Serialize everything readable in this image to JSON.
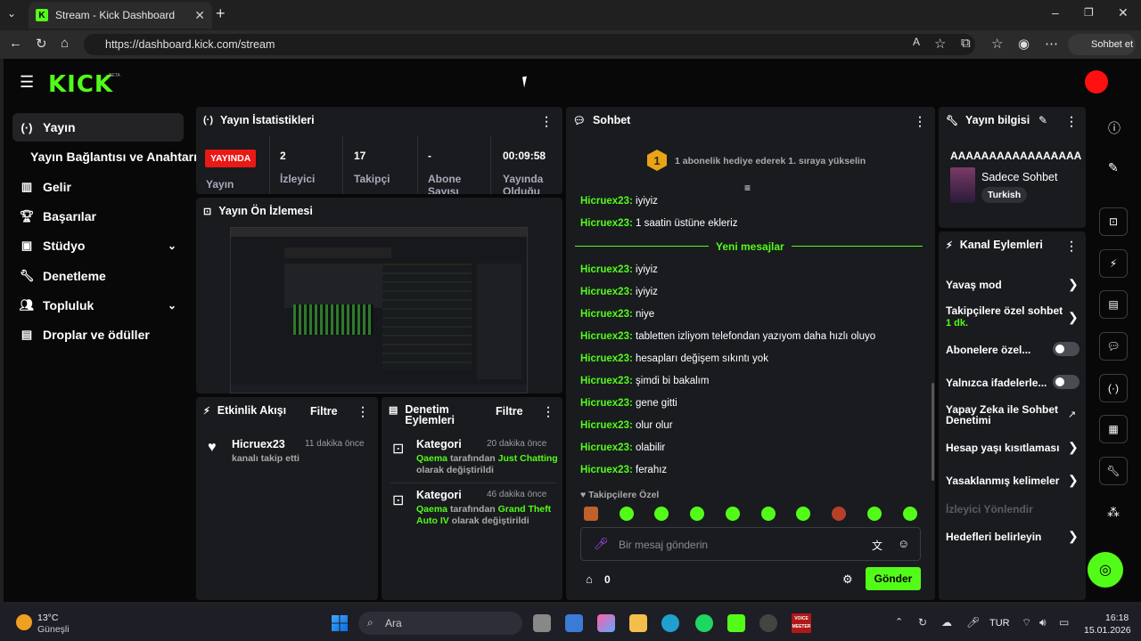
{
  "browser": {
    "tab_title": "Stream - Kick Dashboard",
    "url": "https://dashboard.kick.com/stream",
    "copilot_label": "Sohbet et"
  },
  "logo": {
    "text": "KICK",
    "badge": "BETA"
  },
  "sidebar": {
    "items": [
      {
        "label": "Yayın",
        "icon": "broadcast-icon"
      },
      {
        "label": "Yayın Bağlantısı ve Anahtarı",
        "icon": ""
      },
      {
        "label": "Gelir",
        "icon": "chart-icon"
      },
      {
        "label": "Başarılar",
        "icon": "trophy-icon"
      },
      {
        "label": "Stüdyo",
        "icon": "studio-icon"
      },
      {
        "label": "Denetleme",
        "icon": "wrench-icon"
      },
      {
        "label": "Topluluk",
        "icon": "people-icon"
      },
      {
        "label": "Droplar ve ödüller",
        "icon": "gift-icon"
      }
    ]
  },
  "stats": {
    "title": "Yayın İstatistikleri",
    "live_badge": "YAYINDA",
    "live_label": "Yayın",
    "viewers_value": "2",
    "viewers_label": "İzleyici",
    "followers_value": "17",
    "followers_label": "Takipçi",
    "subs_value": "-",
    "subs_label": "Abone Sayısı",
    "uptime_value": "00:09:58",
    "uptime_label": "Yayında Olduğu"
  },
  "preview": {
    "title": "Yayın Ön İzlemesi"
  },
  "activity": {
    "title": "Etkinlik Akışı",
    "filter": "Filtre",
    "items": [
      {
        "user": "Hicruex23",
        "time": "11 dakika önce",
        "text": "kanalı takip etti"
      }
    ]
  },
  "moderation": {
    "title": "Denetim Eylemleri",
    "filter": "Filtre",
    "items": [
      {
        "label": "Kategori",
        "time": "20 dakika önce",
        "user": "Qaema",
        "mid": "tarafından",
        "value": "Just Chatting",
        "suffix": "olarak değiştirildi"
      },
      {
        "label": "Kategori",
        "time": "46 dakika önce",
        "user": "Qaema",
        "mid": "tarafından",
        "value": "Grand Theft Auto IV",
        "suffix": "olarak değiştirildi"
      }
    ]
  },
  "chat": {
    "title": "Sohbet",
    "pinned": "1 abonelik hediye ederek 1. sıraya yükselin",
    "pinned_rank": "1",
    "new_messages": "Yeni mesajlar",
    "messages_before": [
      {
        "user": "Hicruex23:",
        "text": "iyiyiz"
      },
      {
        "user": "Hicruex23:",
        "text": "1 saatin üstüne ekleriz"
      }
    ],
    "messages_after": [
      {
        "user": "Hicruex23:",
        "text": "iyiyiz"
      },
      {
        "user": "Hicruex23:",
        "text": "iyiyiz"
      },
      {
        "user": "Hicruex23:",
        "text": "niye"
      },
      {
        "user": "Hicruex23:",
        "text": "tabletten izliyom telefondan yazıyom daha hızlı oluyo"
      },
      {
        "user": "Hicruex23:",
        "text": "hesapları değişem sıkıntı yok"
      },
      {
        "user": "Hicruex23:",
        "text": "şimdi bi bakalım"
      },
      {
        "user": "Hicruex23:",
        "text": "gene gitti"
      },
      {
        "user": "Hicruex23:",
        "text": "olur olur"
      },
      {
        "user": "Hicruex23:",
        "text": "olabilir"
      },
      {
        "user": "Hicruex23:",
        "text": "ferahız"
      }
    ],
    "followers_only": "Takipçilere Özel",
    "input_placeholder": "Bir mesaj gönderin",
    "points": "0",
    "send_label": "Gönder"
  },
  "info": {
    "title": "Yayın bilgisi",
    "stream_title": "AAAAAAAAAAAAAAAAA",
    "category": "Sadece Sohbet",
    "language": "Turkish"
  },
  "channel_actions": {
    "title": "Kanal Eylemleri",
    "slow_mode": "Yavaş mod",
    "followers_only": "Takipçilere özel sohbet",
    "followers_only_value": "1 dk.",
    "subs_only": "Abonelere özel...",
    "emotes_only": "Yalnızca ifadelerle...",
    "ai_moderation": "Yapay Zeka ile Sohbet Denetimi",
    "account_age": "Hesap yaşı kısıtlaması",
    "banned_words": "Yasaklanmış kelimeler",
    "redirect": "İzleyici Yönlendir",
    "goals": "Hedefleri belirleyin"
  },
  "taskbar": {
    "weather_temp": "13°C",
    "weather_desc": "Güneşli",
    "search": "Ara",
    "lang": "TUR",
    "time": "16:18",
    "date": "15.01.2026",
    "voicemeeter": "VOICE MEETER"
  },
  "colors": {
    "kick_green": "#53fc18",
    "live_red": "#e91916",
    "panel": "#191b1f"
  }
}
